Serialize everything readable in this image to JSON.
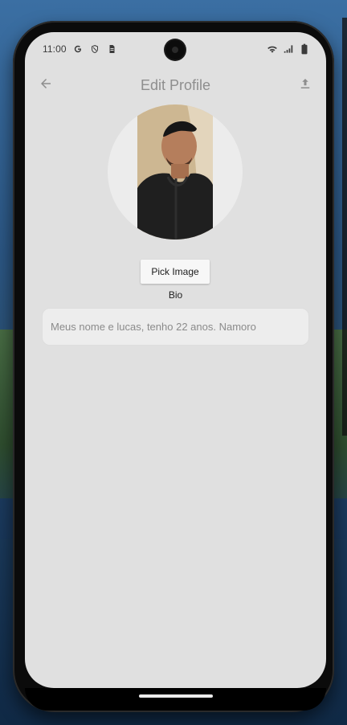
{
  "status_bar": {
    "time": "11:00",
    "left_icons": [
      "google-icon",
      "vpn-shield-icon",
      "sim-card-icon"
    ],
    "right_icons": [
      "wifi-icon",
      "cell-signal-icon",
      "battery-icon"
    ]
  },
  "app_bar": {
    "title": "Edit Profile",
    "back_icon": "arrow-left-icon",
    "action_icon": "upload-icon"
  },
  "profile": {
    "avatar_alt": "profile-photo",
    "pick_image_label": "Pick Image",
    "bio_label": "Bio",
    "bio_value": "Meus nome e lucas, tenho 22 anos. Namoro"
  },
  "colors": {
    "screen_bg": "#e0e0e0",
    "muted_text": "#8e8e8e",
    "bio_field_bg": "#ededed"
  }
}
